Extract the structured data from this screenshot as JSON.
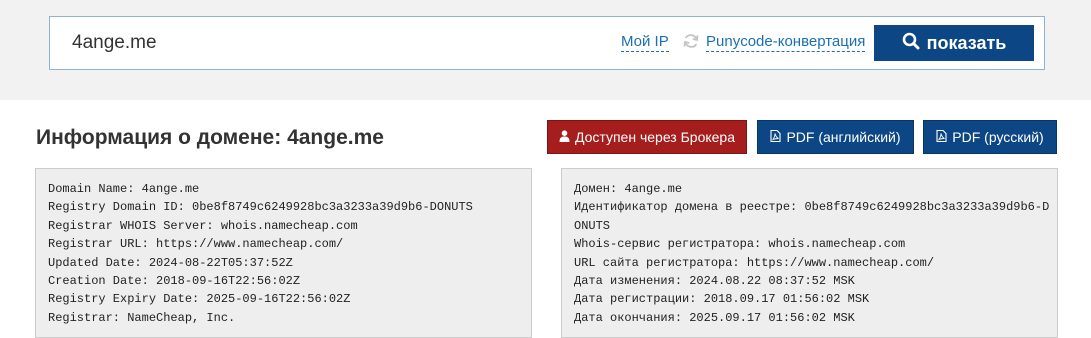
{
  "search": {
    "value": "4ange.me",
    "my_ip_link": "Мой IP",
    "punycode_link": "Punycode-конвертация",
    "show_button_label": "показать"
  },
  "header": {
    "title_prefix": "Информация о домене:",
    "domain": "4ange.me"
  },
  "actions": {
    "broker_label": "Доступен через Брокера",
    "pdf_en_label": "PDF (английский)",
    "pdf_ru_label": "PDF (русский)"
  },
  "whois_en": [
    "Domain Name: 4ange.me",
    "Registry Domain ID: 0be8f8749c6249928bc3a3233a39d9b6-DONUTS",
    "Registrar WHOIS Server: whois.namecheap.com",
    "Registrar URL: https://www.namecheap.com/",
    "Updated Date: 2024-08-22T05:37:52Z",
    "Creation Date: 2018-09-16T22:56:02Z",
    "Registry Expiry Date: 2025-09-16T22:56:02Z",
    "Registrar: NameCheap, Inc."
  ],
  "whois_ru": [
    "Домен: 4ange.me",
    "Идентификатор домена в реестре: 0be8f8749c6249928bc3a3233a39d9b6-D",
    "ONUTS",
    "Whois-сервис регистратора: whois.namecheap.com",
    "URL сайта регистратора: https://www.namecheap.com/",
    "Дата изменения: 2024.08.22 08:37:52 MSK",
    "Дата регистрации: 2018.09.17 01:56:02 MSK",
    "Дата окончания: 2025.09.17 01:56:02 MSK"
  ],
  "icons": {
    "search": "search-icon",
    "refresh": "refresh-icon",
    "user": "user-icon",
    "pdf": "pdf-file-icon"
  },
  "colors": {
    "primary_button": "#0d4684",
    "broker_button": "#a51d1d",
    "link": "#1a6fb5",
    "panel_bg": "#eeeeee"
  }
}
